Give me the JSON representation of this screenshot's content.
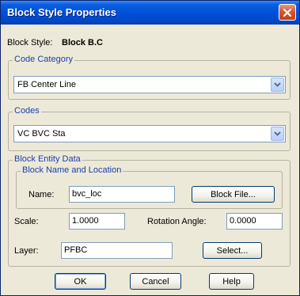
{
  "window": {
    "title": "Block Style Properties"
  },
  "block_style": {
    "label": "Block Style:",
    "value": "Block B.C"
  },
  "code_category": {
    "legend": "Code Category",
    "selected": "FB Center Line"
  },
  "codes": {
    "legend": "Codes",
    "selected": "VC BVC Sta"
  },
  "block_entity_data": {
    "legend": "Block Entity Data",
    "name_location": {
      "legend": "Block Name and Location",
      "name_label": "Name:",
      "name_value": "bvc_loc",
      "block_file_button": "Block File..."
    },
    "scale_label": "Scale:",
    "scale_value": "1.0000",
    "rotation_label": "Rotation Angle:",
    "rotation_value": "0.0000",
    "layer_label": "Layer:",
    "layer_value": "PFBC",
    "select_button": "Select..."
  },
  "buttons": {
    "ok": "OK",
    "cancel": "Cancel",
    "help": "Help"
  },
  "icons": {
    "close": "close-icon",
    "dropdown": "chevron-down-icon"
  },
  "colors": {
    "titlebar": "#0050d8",
    "dialog_bg": "#ece9d8",
    "group_label": "#1a3fa8",
    "close_button": "#d8562e"
  }
}
